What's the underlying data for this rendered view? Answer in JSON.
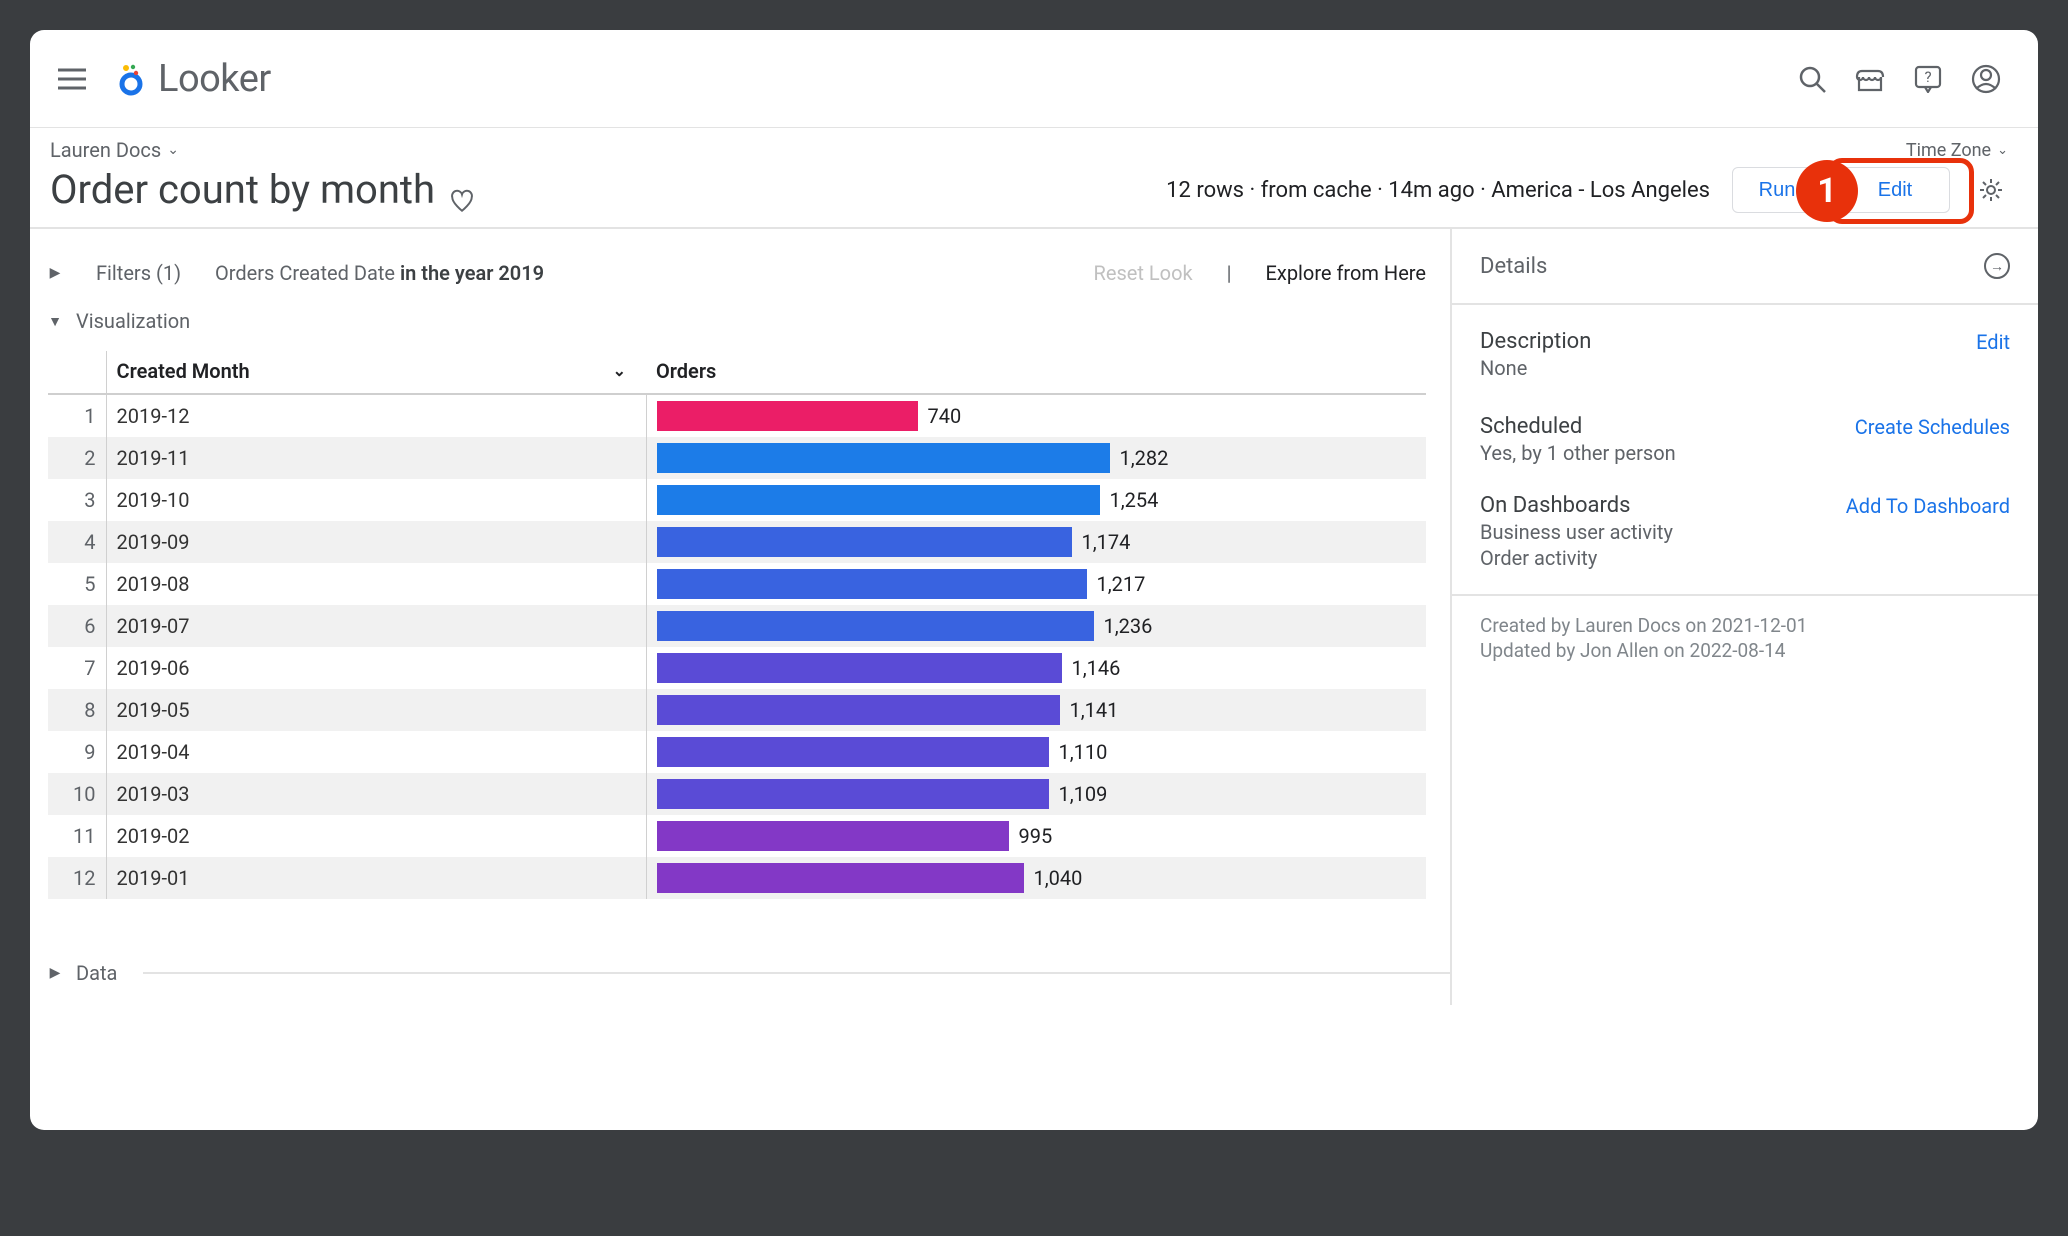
{
  "brand": {
    "name": "Looker"
  },
  "breadcrumb": {
    "label": "Lauren Docs"
  },
  "page": {
    "title": "Order count by month"
  },
  "timezone": {
    "label": "Time Zone"
  },
  "meta": {
    "status": "12 rows · from cache · 14m ago · America - Los Angeles"
  },
  "buttons": {
    "run": "Run",
    "edit": "Edit"
  },
  "callout": {
    "num": "1"
  },
  "filters": {
    "label": "Filters (1)",
    "desc_field": "Orders Created Date ",
    "desc_bold": "in the year 2019",
    "reset": "Reset Look",
    "explore": "Explore from Here"
  },
  "viz": {
    "label": "Visualization",
    "col_month": "Created Month",
    "col_orders": "Orders"
  },
  "data_section": {
    "label": "Data"
  },
  "sidebar": {
    "details_title": "Details",
    "desc_title": "Description",
    "desc_edit": "Edit",
    "desc_value": "None",
    "sched_title": "Scheduled",
    "sched_link": "Create Schedules",
    "sched_value": "Yes, by 1 other person",
    "dash_title": "On Dashboards",
    "dash_link": "Add To Dashboard",
    "dash_items": [
      "Business user activity",
      "Order activity"
    ],
    "created": "Created by Lauren Docs on 2021-12-01",
    "updated": "Updated by Jon Allen on 2022-08-14"
  },
  "chart_data": {
    "type": "bar",
    "title": "Order count by month",
    "xlabel": "Orders",
    "ylabel": "Created Month",
    "categories": [
      "2019-12",
      "2019-11",
      "2019-10",
      "2019-09",
      "2019-08",
      "2019-07",
      "2019-06",
      "2019-05",
      "2019-04",
      "2019-03",
      "2019-02",
      "2019-01"
    ],
    "values": [
      740,
      1282,
      1254,
      1174,
      1217,
      1236,
      1146,
      1141,
      1110,
      1109,
      995,
      1040
    ],
    "colors": [
      "#eb1e67",
      "#1c7ce8",
      "#1c7ce8",
      "#3963e0",
      "#3963e0",
      "#3963e0",
      "#5a4bd6",
      "#5a4bd6",
      "#5a4bd6",
      "#5a4bd6",
      "#8338c6",
      "#8338c6"
    ],
    "xlim": [
      0,
      1500
    ]
  }
}
